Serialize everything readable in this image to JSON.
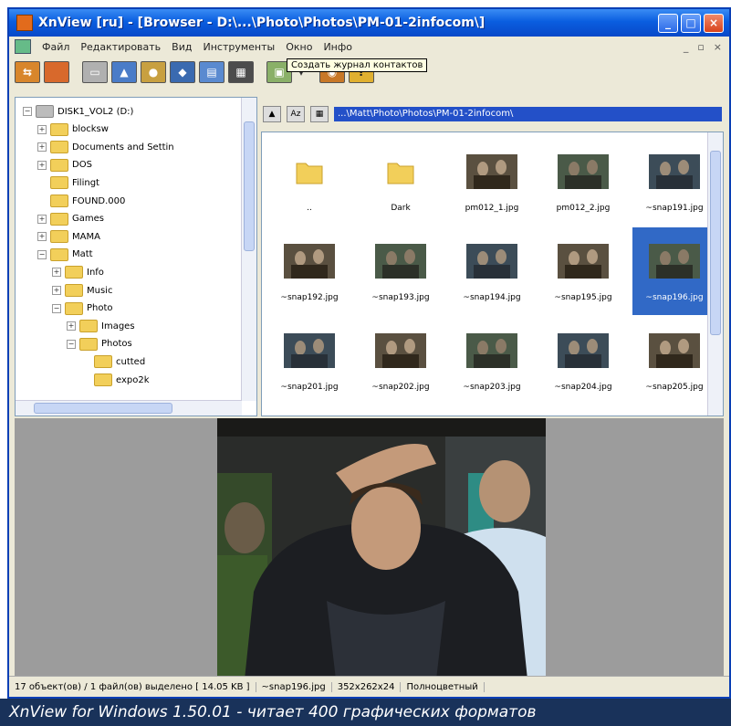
{
  "window": {
    "title": "XnView [ru] - [Browser - D:\\...\\Photo\\Photos\\PM-01-2infocom\\]",
    "buttons": [
      "_",
      "□",
      "×"
    ]
  },
  "menubar": {
    "items": [
      "Файл",
      "Редактировать",
      "Вид",
      "Инструменты",
      "Окно",
      "Инфо"
    ],
    "mdi_buttons": [
      "_",
      "▫",
      "×"
    ]
  },
  "toolbar": {
    "tooltip": "Создать журнал контактов"
  },
  "tree": {
    "items": [
      {
        "label": "DISK1_VOL2 (D:)",
        "indent": 0,
        "expander": "−"
      },
      {
        "label": "blocksw",
        "indent": 1,
        "expander": "+"
      },
      {
        "label": "Documents and Settin",
        "indent": 1,
        "expander": "+"
      },
      {
        "label": "DOS",
        "indent": 1,
        "expander": "+"
      },
      {
        "label": "Filingt",
        "indent": 1,
        "expander": ""
      },
      {
        "label": "FOUND.000",
        "indent": 1,
        "expander": ""
      },
      {
        "label": "Games",
        "indent": 1,
        "expander": "+"
      },
      {
        "label": "MAMA",
        "indent": 1,
        "expander": "+"
      },
      {
        "label": "Matt",
        "indent": 1,
        "expander": "−"
      },
      {
        "label": "Info",
        "indent": 2,
        "expander": "+"
      },
      {
        "label": "Music",
        "indent": 2,
        "expander": "+"
      },
      {
        "label": "Photo",
        "indent": 2,
        "expander": "−"
      },
      {
        "label": "Images",
        "indent": 3,
        "expander": "+"
      },
      {
        "label": "Photos",
        "indent": 3,
        "expander": "−"
      },
      {
        "label": "cutted",
        "indent": 4,
        "expander": ""
      },
      {
        "label": "expo2k",
        "indent": 4,
        "expander": ""
      }
    ]
  },
  "pathbar": {
    "path": "...\\Matt\\Photo\\Photos\\PM-01-2infocom\\"
  },
  "thumbnails": [
    {
      "label": "..",
      "kind": "folder"
    },
    {
      "label": "Dark",
      "kind": "folder"
    },
    {
      "label": "pm012_1.jpg",
      "kind": "photo"
    },
    {
      "label": "pm012_2.jpg",
      "kind": "photo"
    },
    {
      "label": "~snap191.jpg",
      "kind": "photo"
    },
    {
      "label": "~snap192.jpg",
      "kind": "photo"
    },
    {
      "label": "~snap193.jpg",
      "kind": "photo"
    },
    {
      "label": "~snap194.jpg",
      "kind": "photo"
    },
    {
      "label": "~snap195.jpg",
      "kind": "photo"
    },
    {
      "label": "~snap196.jpg",
      "kind": "photo",
      "selected": true
    },
    {
      "label": "~snap201.jpg",
      "kind": "photo"
    },
    {
      "label": "~snap202.jpg",
      "kind": "photo"
    },
    {
      "label": "~snap203.jpg",
      "kind": "photo"
    },
    {
      "label": "~snap204.jpg",
      "kind": "photo"
    },
    {
      "label": "~snap205.jpg",
      "kind": "photo"
    }
  ],
  "statusbar": {
    "selection": "17 объект(ов) / 1 файл(ов) выделено  [ 14.05 KB ]",
    "filename": "~snap196.jpg",
    "dimensions": "352x262x24",
    "color_mode": "Полноцветный"
  },
  "caption": "XnView for Windows 1.50.01 - читает 400 графических форматов"
}
